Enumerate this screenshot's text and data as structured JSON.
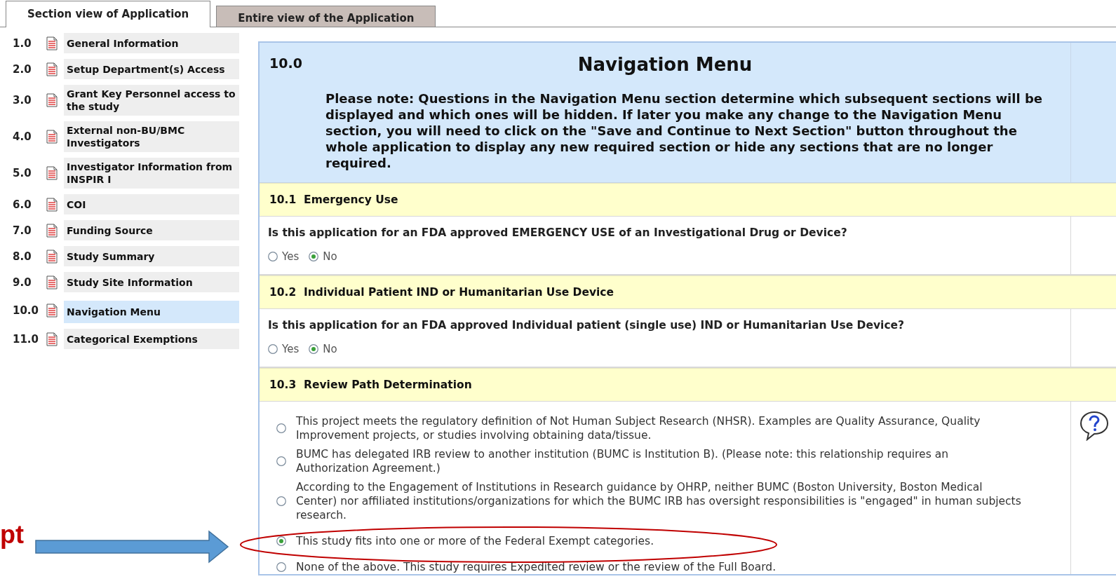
{
  "tabs": [
    {
      "label": "Section view of Application",
      "selected": true
    },
    {
      "label": "Entire view of the Application",
      "selected": false
    }
  ],
  "sidebar": {
    "items": [
      {
        "number": "1.0",
        "label": "General Information",
        "selected": false
      },
      {
        "number": "2.0",
        "label": "Setup Department(s) Access",
        "selected": false
      },
      {
        "number": "3.0",
        "label": "Grant Key Personnel access to the study",
        "selected": false
      },
      {
        "number": "4.0",
        "label": "External non-BU/BMC Investigators",
        "selected": false
      },
      {
        "number": "5.0",
        "label": "Investigator Information from INSPIR I",
        "selected": false
      },
      {
        "number": "6.0",
        "label": "COI",
        "selected": false
      },
      {
        "number": "7.0",
        "label": "Funding Source",
        "selected": false
      },
      {
        "number": "8.0",
        "label": "Study Summary",
        "selected": false
      },
      {
        "number": "9.0",
        "label": "Study Site Information",
        "selected": false
      },
      {
        "number": "10.0",
        "label": "Navigation Menu",
        "selected": true
      },
      {
        "number": "11.0",
        "label": "Categorical Exemptions",
        "selected": false
      }
    ]
  },
  "section": {
    "number": "10.0",
    "title": "Navigation Menu",
    "note": "Please note: Questions in the Navigation Menu section determine which subsequent sections will be displayed and which ones will be hidden. If later you make any change to the Navigation Menu section, you will need to click on the \"Save and Continue to Next Section\" button throughout the whole application to display any new required section or hide any sections that are no longer required."
  },
  "questions": [
    {
      "number": "10.1",
      "heading": "Emergency Use",
      "prompt": "Is this application for an FDA approved EMERGENCY USE of an Investigational Drug or Device?",
      "options": [
        {
          "label": "Yes",
          "selected": false
        },
        {
          "label": "No",
          "selected": true
        }
      ]
    },
    {
      "number": "10.2",
      "heading": "Individual Patient IND or Humanitarian Use Device",
      "prompt": "Is this application for an FDA approved Individual patient (single use) IND or Humanitarian Use Device?",
      "options": [
        {
          "label": "Yes",
          "selected": false
        },
        {
          "label": "No",
          "selected": true
        }
      ]
    }
  ],
  "review_path": {
    "number": "10.3",
    "heading": "Review Path Determination",
    "options": [
      {
        "label": "This project meets the regulatory definition of Not Human Subject Research (NHSR). Examples are Quality Assurance, Quality Improvement projects, or studies involving obtaining data/tissue.",
        "selected": false
      },
      {
        "label": "BUMC has delegated IRB review to another institution (BUMC is Institution B). (Please note: this relationship requires an Authorization Agreement.)",
        "selected": false
      },
      {
        "label": "According to the Engagement of Institutions in Research guidance by OHRP, neither BUMC (Boston University, Boston Medical Center) nor affiliated institutions/organizations for which the BUMC IRB has oversight responsibilities is \"engaged\" in human subjects research.",
        "selected": false
      },
      {
        "label": "This study fits into one or more of the Federal Exempt categories.",
        "selected": true
      },
      {
        "label": "None of the above. This study requires Expedited review or the review of the Full Board.",
        "selected": false
      }
    ]
  },
  "annotation": {
    "text": "pt"
  }
}
